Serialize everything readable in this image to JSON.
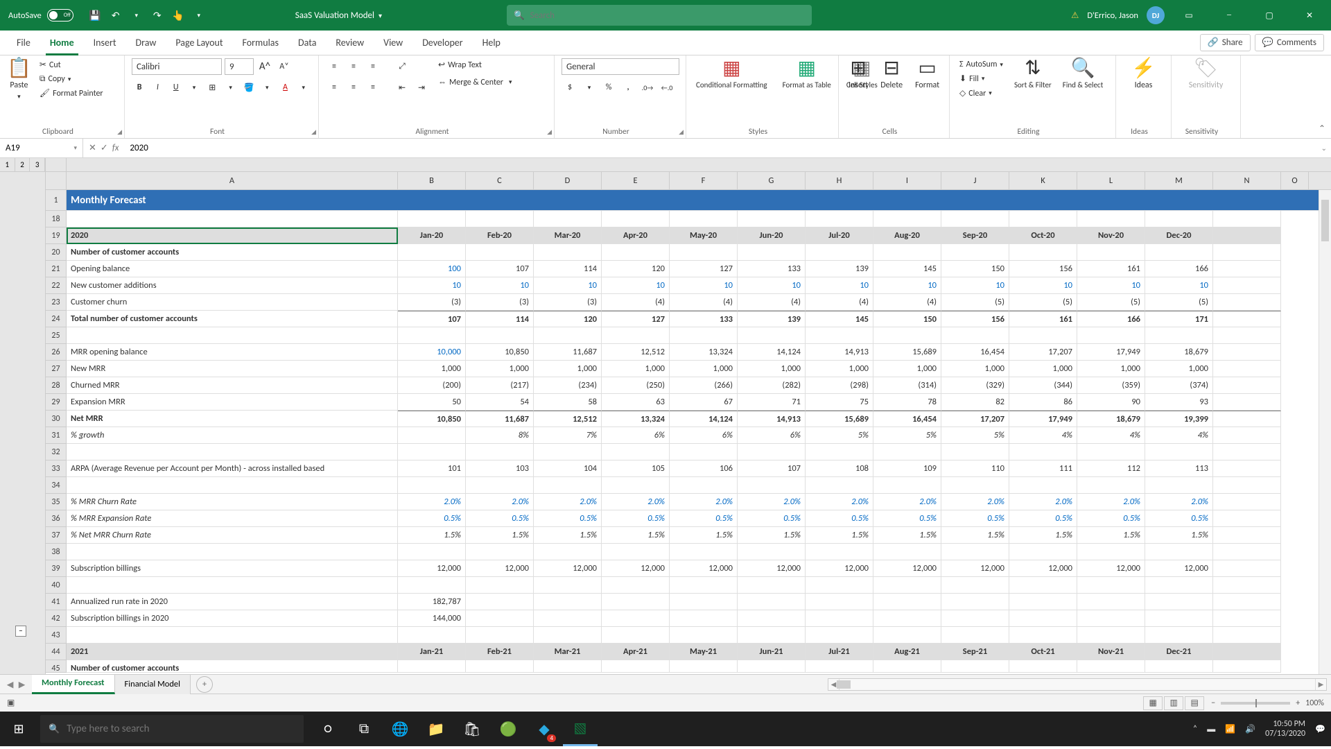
{
  "titlebar": {
    "autosave_label": "AutoSave",
    "autosave_state": "Off",
    "doc_title": "SaaS Valuation Model",
    "search_placeholder": "Search",
    "user_name": "D'Errico, Jason",
    "user_initials": "DJ"
  },
  "tabs": [
    "File",
    "Home",
    "Insert",
    "Draw",
    "Page Layout",
    "Formulas",
    "Data",
    "Review",
    "View",
    "Developer",
    "Help"
  ],
  "tabs_active": "Home",
  "ribbon_right": {
    "share": "Share",
    "comments": "Comments"
  },
  "ribbon": {
    "clipboard": {
      "paste": "Paste",
      "cut": "Cut",
      "copy": "Copy",
      "fp": "Format Painter",
      "label": "Clipboard"
    },
    "font": {
      "name": "Calibri",
      "size": "9",
      "label": "Font"
    },
    "alignment": {
      "wrap": "Wrap Text",
      "merge": "Merge & Center",
      "label": "Alignment"
    },
    "number": {
      "format": "General",
      "label": "Number"
    },
    "styles": {
      "cf": "Conditional Formatting",
      "fat": "Format as Table",
      "cs": "Cell Styles",
      "label": "Styles"
    },
    "cells": {
      "ins": "Insert",
      "del": "Delete",
      "fmt": "Format",
      "label": "Cells"
    },
    "editing": {
      "autosum": "AutoSum",
      "fill": "Fill",
      "clear": "Clear",
      "sort": "Sort & Filter",
      "find": "Find & Select",
      "label": "Editing"
    },
    "ideas": {
      "label": "Ideas",
      "btn": "Ideas"
    },
    "sens": {
      "label": "Sensitivity",
      "btn": "Sensitivity"
    }
  },
  "namebox": "A19",
  "formula": "2020",
  "outline_levels": [
    "1",
    "2",
    "3"
  ],
  "columns": [
    "A",
    "B",
    "C",
    "D",
    "E",
    "F",
    "G",
    "H",
    "I",
    "J",
    "K",
    "L",
    "M",
    "N",
    "O"
  ],
  "months20": [
    "Jan-20",
    "Feb-20",
    "Mar-20",
    "Apr-20",
    "May-20",
    "Jun-20",
    "Jul-20",
    "Aug-20",
    "Sep-20",
    "Oct-20",
    "Nov-20",
    "Dec-20"
  ],
  "months21": [
    "Jan-21",
    "Feb-21",
    "Mar-21",
    "Apr-21",
    "May-21",
    "Jun-21",
    "Jul-21",
    "Aug-21",
    "Sep-21",
    "Oct-21",
    "Nov-21",
    "Dec-21"
  ],
  "rows": {
    "r1_title": "Monthly Forecast",
    "r19": "2020",
    "r20": "Number of customer accounts",
    "r21": {
      "l": "Opening balance",
      "v": [
        "100",
        "107",
        "114",
        "120",
        "127",
        "133",
        "139",
        "145",
        "150",
        "156",
        "161",
        "166"
      ],
      "blue0": true
    },
    "r22": {
      "l": "New customer additions",
      "v": [
        "10",
        "10",
        "10",
        "10",
        "10",
        "10",
        "10",
        "10",
        "10",
        "10",
        "10",
        "10"
      ],
      "blue": true
    },
    "r23": {
      "l": "Customer churn",
      "v": [
        "(3)",
        "(3)",
        "(3)",
        "(4)",
        "(4)",
        "(4)",
        "(4)",
        "(4)",
        "(5)",
        "(5)",
        "(5)",
        "(5)"
      ]
    },
    "r24": {
      "l": "Total number of customer accounts",
      "v": [
        "107",
        "114",
        "120",
        "127",
        "133",
        "139",
        "145",
        "150",
        "156",
        "161",
        "166",
        "171"
      ],
      "bold": true
    },
    "r26": {
      "l": "MRR opening balance",
      "v": [
        "10,000",
        "10,850",
        "11,687",
        "12,512",
        "13,324",
        "14,124",
        "14,913",
        "15,689",
        "16,454",
        "17,207",
        "17,949",
        "18,679"
      ],
      "blue0": true
    },
    "r27": {
      "l": "New MRR",
      "v": [
        "1,000",
        "1,000",
        "1,000",
        "1,000",
        "1,000",
        "1,000",
        "1,000",
        "1,000",
        "1,000",
        "1,000",
        "1,000",
        "1,000"
      ]
    },
    "r28": {
      "l": "Churned MRR",
      "v": [
        "(200)",
        "(217)",
        "(234)",
        "(250)",
        "(266)",
        "(282)",
        "(298)",
        "(314)",
        "(329)",
        "(344)",
        "(359)",
        "(374)"
      ]
    },
    "r29": {
      "l": "Expansion MRR",
      "v": [
        "50",
        "54",
        "58",
        "63",
        "67",
        "71",
        "75",
        "78",
        "82",
        "86",
        "90",
        "93"
      ]
    },
    "r30": {
      "l": "Net MRR",
      "v": [
        "10,850",
        "11,687",
        "12,512",
        "13,324",
        "14,124",
        "14,913",
        "15,689",
        "16,454",
        "17,207",
        "17,949",
        "18,679",
        "19,399"
      ],
      "bold": true
    },
    "r31": {
      "l": "   % growth",
      "v": [
        "",
        "8%",
        "7%",
        "6%",
        "6%",
        "6%",
        "5%",
        "5%",
        "5%",
        "4%",
        "4%",
        "4%"
      ],
      "italic": true
    },
    "r33": {
      "l": "ARPA (Average Revenue per Account per Month) - across installed based",
      "v": [
        "101",
        "103",
        "104",
        "105",
        "106",
        "107",
        "108",
        "109",
        "110",
        "111",
        "112",
        "113"
      ]
    },
    "r35": {
      "l": "% MRR Churn Rate",
      "v": [
        "2.0%",
        "2.0%",
        "2.0%",
        "2.0%",
        "2.0%",
        "2.0%",
        "2.0%",
        "2.0%",
        "2.0%",
        "2.0%",
        "2.0%",
        "2.0%"
      ],
      "blue": true,
      "italic": true
    },
    "r36": {
      "l": "% MRR Expansion Rate",
      "v": [
        "0.5%",
        "0.5%",
        "0.5%",
        "0.5%",
        "0.5%",
        "0.5%",
        "0.5%",
        "0.5%",
        "0.5%",
        "0.5%",
        "0.5%",
        "0.5%"
      ],
      "blue": true,
      "italic": true
    },
    "r37": {
      "l": "% Net MRR Churn Rate",
      "v": [
        "1.5%",
        "1.5%",
        "1.5%",
        "1.5%",
        "1.5%",
        "1.5%",
        "1.5%",
        "1.5%",
        "1.5%",
        "1.5%",
        "1.5%",
        "1.5%"
      ],
      "italic": true
    },
    "r39": {
      "l": "Subscription billings",
      "v": [
        "12,000",
        "12,000",
        "12,000",
        "12,000",
        "12,000",
        "12,000",
        "12,000",
        "12,000",
        "12,000",
        "12,000",
        "12,000",
        "12,000"
      ]
    },
    "r41": {
      "l": "Annualized run rate in 2020",
      "v": [
        "182,787",
        "",
        "",
        "",
        "",
        "",
        "",
        "",
        "",
        "",
        "",
        ""
      ]
    },
    "r42": {
      "l": "Subscription billings in 2020",
      "v": [
        "144,000",
        "",
        "",
        "",
        "",
        "",
        "",
        "",
        "",
        "",
        "",
        ""
      ]
    },
    "r44": "2021",
    "r45": "Number of customer accounts"
  },
  "sheet_tabs": {
    "active": "Monthly Forecast",
    "other": "Financial Model"
  },
  "statusbar": {
    "rec": "",
    "zoom": "100%"
  },
  "taskbar": {
    "search_placeholder": "Type here to search",
    "time": "10:50 PM",
    "date": "07/13/2020",
    "notif": "4"
  }
}
